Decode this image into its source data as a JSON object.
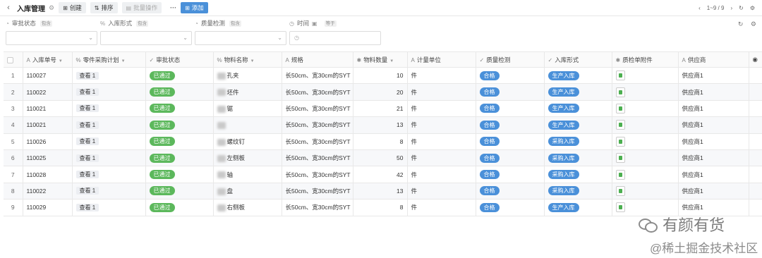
{
  "toolbar": {
    "title": "入库管理",
    "create": "创建",
    "sort": "排序",
    "batch": "批量操作",
    "more": "···",
    "add": "添加",
    "pager": "1~9 / 9"
  },
  "filters": [
    {
      "label": "审批状态",
      "tag": "包含",
      "icon": "check-circle-icon",
      "kind": "select"
    },
    {
      "label": "入库形式",
      "tag": "包含",
      "icon": "link-icon",
      "kind": "select"
    },
    {
      "label": "质量检测",
      "tag": "包含",
      "icon": "check-circle-icon",
      "kind": "select"
    },
    {
      "label": "时间",
      "tag": "等于",
      "icon": "clock-icon",
      "kind": "date"
    }
  ],
  "columns": [
    {
      "label": "入库单号",
      "icon": "A",
      "sort": true
    },
    {
      "label": "零件采购计划",
      "icon": "%"
    },
    {
      "label": "审批状态",
      "icon": "✓"
    },
    {
      "label": "物料名称",
      "icon": "%"
    },
    {
      "label": "规格",
      "icon": "A"
    },
    {
      "label": "物料数量",
      "icon": "✱"
    },
    {
      "label": "计量单位",
      "icon": "A"
    },
    {
      "label": "质量检测",
      "icon": "✓"
    },
    {
      "label": "入库形式",
      "icon": "✓"
    },
    {
      "label": "质检单附件",
      "icon": "✱"
    },
    {
      "label": "供应商",
      "icon": "A"
    }
  ],
  "rows": [
    {
      "idx": "1",
      "no": "110027",
      "plan": "查看 1",
      "status": "已通过",
      "name": "孔夹",
      "spec": "长50cm、宽30cm的SYT",
      "qty": "10",
      "unit": "件",
      "qc": "合格",
      "form": "生产入库",
      "supplier": "供应商1"
    },
    {
      "idx": "2",
      "no": "110022",
      "plan": "查看 1",
      "status": "已通过",
      "name": "坯件",
      "spec": "长50cm、宽30cm的SYT",
      "qty": "20",
      "unit": "件",
      "qc": "合格",
      "form": "生产入库",
      "supplier": "供应商1"
    },
    {
      "idx": "3",
      "no": "110021",
      "plan": "查看 1",
      "status": "已通过",
      "name": "锯",
      "spec": "长50cm、宽30cm的SYT",
      "qty": "21",
      "unit": "件",
      "qc": "合格",
      "form": "生产入库",
      "supplier": "供应商1"
    },
    {
      "idx": "4",
      "no": "110021",
      "plan": "查看 1",
      "status": "已通过",
      "name": "",
      "spec": "长50cm、宽30cm的SYT",
      "qty": "13",
      "unit": "件",
      "qc": "合格",
      "form": "生产入库",
      "supplier": "供应商1"
    },
    {
      "idx": "5",
      "no": "110026",
      "plan": "查看 1",
      "status": "已通过",
      "name": "螺纹钉",
      "spec": "长50cm、宽30cm的SYT",
      "qty": "8",
      "unit": "件",
      "qc": "合格",
      "form": "采购入库",
      "supplier": "供应商1"
    },
    {
      "idx": "6",
      "no": "110025",
      "plan": "查看 1",
      "status": "已通过",
      "name": "左侧板",
      "spec": "长50cm、宽30cm的SYT",
      "qty": "50",
      "unit": "件",
      "qc": "合格",
      "form": "采购入库",
      "supplier": "供应商1"
    },
    {
      "idx": "7",
      "no": "110028",
      "plan": "查看 1",
      "status": "已通过",
      "name": "轴",
      "spec": "长50cm、宽30cm的SYT",
      "qty": "42",
      "unit": "件",
      "qc": "合格",
      "form": "采购入库",
      "supplier": "供应商1"
    },
    {
      "idx": "8",
      "no": "110022",
      "plan": "查看 1",
      "status": "已通过",
      "name": "盘",
      "spec": "长50cm、宽30cm的SYT",
      "qty": "13",
      "unit": "件",
      "qc": "合格",
      "form": "采购入库",
      "supplier": "供应商1"
    },
    {
      "idx": "9",
      "no": "110029",
      "plan": "查看 1",
      "status": "已通过",
      "name": "右侧板",
      "spec": "长50cm、宽30cm的SYT",
      "qty": "8",
      "unit": "件",
      "qc": "合格",
      "form": "生产入库",
      "supplier": "供应商1"
    }
  ],
  "watermark": {
    "line1": "有颜有货",
    "line2": "@稀土掘金技术社区"
  },
  "colors": {
    "primary": "#4a90d9",
    "success": "#5cb85c"
  }
}
